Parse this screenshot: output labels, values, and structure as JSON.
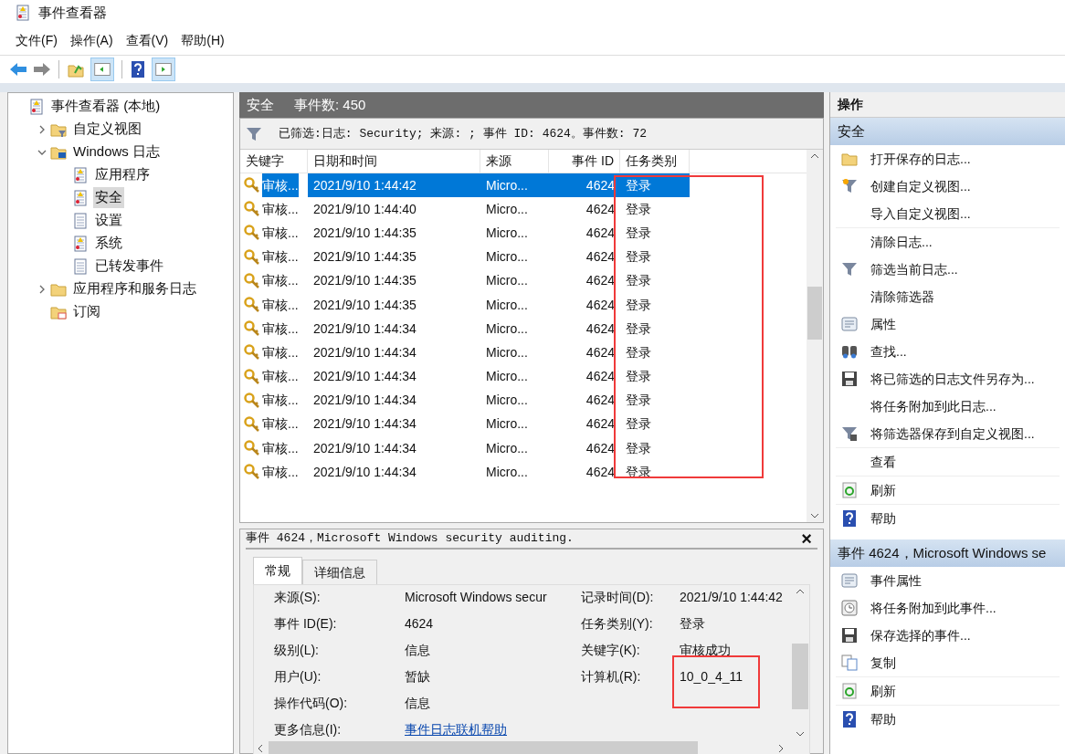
{
  "window": {
    "title": "事件查看器"
  },
  "menu": [
    "文件(F)",
    "操作(A)",
    "查看(V)",
    "帮助(H)"
  ],
  "tree": [
    {
      "label": "事件查看器 (本地)",
      "kind": "log",
      "selected": false,
      "children": [
        {
          "label": "自定义视图",
          "kind": "filter-folder",
          "expanded": false,
          "selected": false
        },
        {
          "label": "Windows 日志",
          "kind": "win-folder",
          "expanded": true,
          "selected": false,
          "children": [
            {
              "label": "应用程序",
              "kind": "log",
              "selected": false
            },
            {
              "label": "安全",
              "kind": "log",
              "selected": true
            },
            {
              "label": "设置",
              "kind": "plain-log",
              "selected": false
            },
            {
              "label": "系统",
              "kind": "log",
              "selected": false
            },
            {
              "label": "已转发事件",
              "kind": "plain-log",
              "selected": false
            }
          ]
        },
        {
          "label": "应用程序和服务日志",
          "kind": "folder",
          "expanded": false,
          "selected": false
        },
        {
          "label": "订阅",
          "kind": "sub-folder",
          "selected": false
        }
      ]
    }
  ],
  "log_header": {
    "name": "安全",
    "count": "事件数: 450"
  },
  "filter_text": "已筛选:日志: Security; 来源: ; 事件 ID: 4624。事件数: 72",
  "table": {
    "columns": [
      "关键字",
      "日期和时间",
      "来源",
      "事件 ID",
      "任务类别"
    ],
    "rows": [
      {
        "keyword": "审核...",
        "date": "2021/9/10 1:44:42",
        "source": "Micro...",
        "id": "4624",
        "category": "登录",
        "selected": true
      },
      {
        "keyword": "审核...",
        "date": "2021/9/10 1:44:40",
        "source": "Micro...",
        "id": "4624",
        "category": "登录",
        "selected": false
      },
      {
        "keyword": "审核...",
        "date": "2021/9/10 1:44:35",
        "source": "Micro...",
        "id": "4624",
        "category": "登录",
        "selected": false
      },
      {
        "keyword": "审核...",
        "date": "2021/9/10 1:44:35",
        "source": "Micro...",
        "id": "4624",
        "category": "登录",
        "selected": false
      },
      {
        "keyword": "审核...",
        "date": "2021/9/10 1:44:35",
        "source": "Micro...",
        "id": "4624",
        "category": "登录",
        "selected": false
      },
      {
        "keyword": "审核...",
        "date": "2021/9/10 1:44:35",
        "source": "Micro...",
        "id": "4624",
        "category": "登录",
        "selected": false
      },
      {
        "keyword": "审核...",
        "date": "2021/9/10 1:44:34",
        "source": "Micro...",
        "id": "4624",
        "category": "登录",
        "selected": false
      },
      {
        "keyword": "审核...",
        "date": "2021/9/10 1:44:34",
        "source": "Micro...",
        "id": "4624",
        "category": "登录",
        "selected": false
      },
      {
        "keyword": "审核...",
        "date": "2021/9/10 1:44:34",
        "source": "Micro...",
        "id": "4624",
        "category": "登录",
        "selected": false
      },
      {
        "keyword": "审核...",
        "date": "2021/9/10 1:44:34",
        "source": "Micro...",
        "id": "4624",
        "category": "登录",
        "selected": false
      },
      {
        "keyword": "审核...",
        "date": "2021/9/10 1:44:34",
        "source": "Micro...",
        "id": "4624",
        "category": "登录",
        "selected": false
      },
      {
        "keyword": "审核...",
        "date": "2021/9/10 1:44:34",
        "source": "Micro...",
        "id": "4624",
        "category": "登录",
        "selected": false
      },
      {
        "keyword": "审核...",
        "date": "2021/9/10 1:44:34",
        "source": "Micro...",
        "id": "4624",
        "category": "登录",
        "selected": false
      }
    ]
  },
  "detail": {
    "title": "事件 4624，Microsoft Windows security auditing.",
    "close": "×",
    "tabs": [
      {
        "label": "常规",
        "selected": true
      },
      {
        "label": "详细信息",
        "selected": false
      }
    ],
    "fields": [
      {
        "label": "来源(S):",
        "value": "Microsoft Windows secur",
        "label2": "记录时间(D):",
        "value2": "2021/9/10 1:44:42"
      },
      {
        "label": "事件 ID(E):",
        "value": "4624",
        "label2": "任务类别(Y):",
        "value2": "登录"
      },
      {
        "label": "级别(L):",
        "value": "信息",
        "label2": "关键字(K):",
        "value2": "审核成功"
      },
      {
        "label": "用户(U):",
        "value": "暂缺",
        "label2": "计算机(R):",
        "value2": "10_0_4_11"
      },
      {
        "label": "操作代码(O):",
        "value": "信息"
      },
      {
        "label": "更多信息(I):",
        "link": "事件日志联机帮助"
      }
    ]
  },
  "actions": {
    "title": "操作",
    "sections": [
      {
        "title": "安全",
        "groups": [
          [
            {
              "label": "打开保存的日志...",
              "kind": "folder"
            },
            {
              "label": "创建自定义视图...",
              "kind": "funnel-star"
            },
            {
              "label": "导入自定义视图..."
            }
          ],
          [
            {
              "label": "清除日志..."
            },
            {
              "label": "筛选当前日志...",
              "kind": "funnel"
            },
            {
              "label": "清除筛选器"
            },
            {
              "label": "属性",
              "kind": "properties"
            },
            {
              "label": "查找...",
              "kind": "binoculars"
            },
            {
              "label": "将已筛选的日志文件另存为...",
              "kind": "save"
            },
            {
              "label": "将任务附加到此日志..."
            },
            {
              "label": "将筛选器保存到自定义视图...",
              "kind": "funnel-save"
            }
          ],
          [
            {
              "label": "查看"
            }
          ],
          [
            {
              "label": "刷新",
              "kind": "refresh"
            }
          ],
          [
            {
              "label": "帮助",
              "kind": "help"
            }
          ]
        ]
      },
      {
        "title": "事件 4624，Microsoft Windows se",
        "groups": [
          [
            {
              "label": "事件属性",
              "kind": "properties"
            },
            {
              "label": "将任务附加到此事件...",
              "kind": "clock"
            },
            {
              "label": "保存选择的事件...",
              "kind": "save"
            },
            {
              "label": "复制",
              "kind": "copy"
            }
          ],
          [
            {
              "label": "刷新",
              "kind": "refresh"
            }
          ],
          [
            {
              "label": "帮助",
              "kind": "help"
            }
          ]
        ]
      }
    ]
  }
}
